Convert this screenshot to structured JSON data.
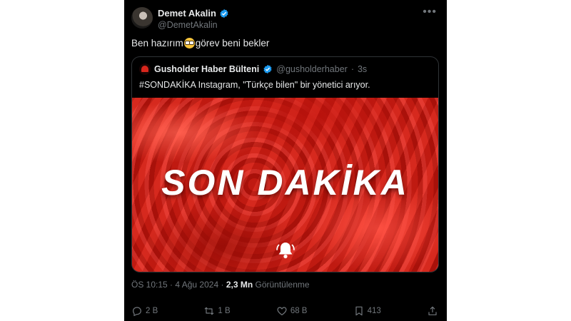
{
  "author": {
    "name": "Demet Akalin",
    "handle": "@DemetAkalin",
    "text_before": "Ben hazırım",
    "text_after": "görev beni bekler"
  },
  "quoted": {
    "name": "Gusholder Haber Bülteni",
    "handle": "@gusholderhaber",
    "separator": "·",
    "time": "3s",
    "text": "#SONDAKİKA Instagram, \"Türkçe bilen\" bir yönetici arıyor.",
    "image_text": "SON DAKİKA"
  },
  "meta": {
    "time": "ÖS 10:15",
    "dot": "·",
    "date": "4 Ağu 2024",
    "views": "2,3 Mn",
    "views_label": "Görüntülenme"
  },
  "actions": {
    "replies": "2 B",
    "reposts": "1 B",
    "likes": "68 B",
    "bookmarks": "413"
  },
  "colors": {
    "background": "#000000",
    "verified": "#1d9bf0",
    "muted": "#71767b",
    "breaking_red": "#c8140d"
  },
  "icons": [
    "verified-badge-icon",
    "more-icon",
    "reply-icon",
    "repost-icon",
    "like-icon",
    "bookmark-icon",
    "share-icon",
    "bell-icon"
  ]
}
